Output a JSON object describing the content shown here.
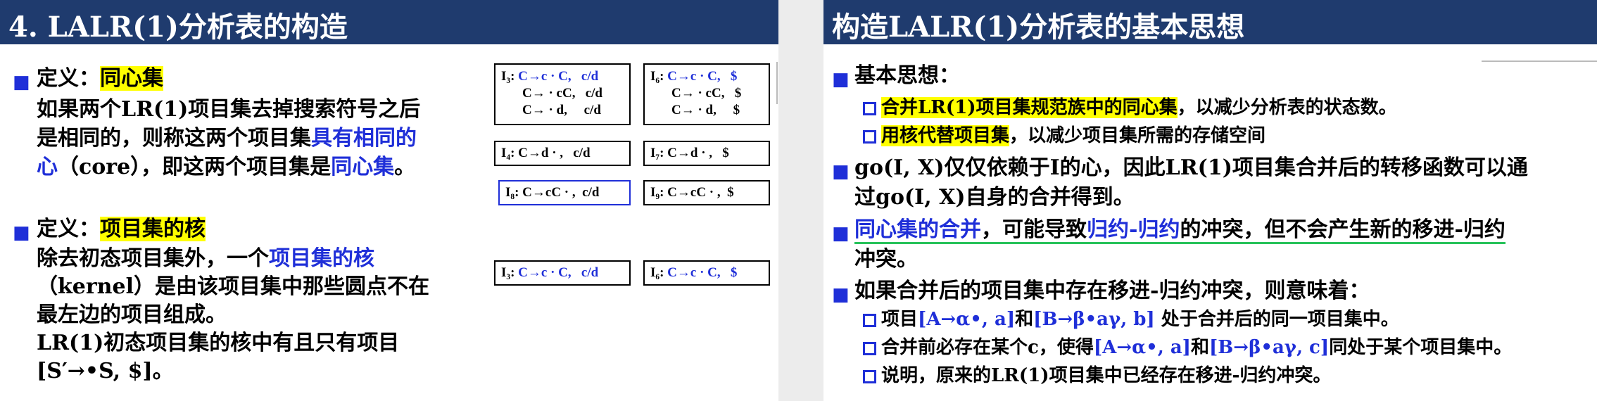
{
  "left": {
    "title": "4. LALR(1)分析表的构造",
    "def1": {
      "label": "定义：",
      "term": "同心集",
      "line1": "如果两个LR(1)项目集去掉搜索符号之后",
      "line2a": "是相同的，则称这两个项目集",
      "line2b": "具有相同的",
      "line3a": "心",
      "line3b": "（core），即这两个项目集是",
      "line3c": "同心集",
      "line3d": "。"
    },
    "def2": {
      "label": "定义：",
      "term": "项目集的核",
      "line1a": "除去初态项目集外，一个",
      "line1b": "项目集的核",
      "line2": "（kernel）是由该项目集中那些圆点不在",
      "line3": "最左边的项目组成。",
      "line4": "LR(1)初态项目集的核中有且只有项目",
      "line5": "[S′→•S, $]。"
    },
    "boxes": {
      "i3": {
        "name": "I₃:",
        "l1": "C→c · C,   c/d",
        "l2": "C→ · cC,   c/d",
        "l3": "C→ · d,     c/d"
      },
      "i6": {
        "name": "I₆:",
        "l1": "C→c · C,   $",
        "l2": "C→ · cC,   $",
        "l3": "C→ · d,     $"
      },
      "i4": {
        "name": "I₄:",
        "l1": "C→d · ,   c/d"
      },
      "i7": {
        "name": "I₇:",
        "l1": "C→d · ,   $"
      },
      "i8": {
        "name": "I₈:",
        "l1": "C→cC · ,  c/d"
      },
      "i9": {
        "name": "I₉:",
        "l1": "C→cC · ,  $"
      },
      "i3b": {
        "name": "I₃:",
        "l1": "C→c · C,   c/d"
      },
      "i6b": {
        "name": "I₆:",
        "l1": "C→c · C,   $"
      }
    }
  },
  "right": {
    "title": "构造LALR(1)分析表的基本思想",
    "b1": "基本思想：",
    "b1s1a": "合并LR(1)项目集规范族中的同心集",
    "b1s1b": "，以减少分析表的状态数。",
    "b1s2a": "用核代替项目集",
    "b1s2b": "，以减少项目集所需的存储空间",
    "b2l1": "go(I, X)仅仅依赖于I的心，因此LR(1)项目集合并后的转移函数可以通",
    "b2l2": "过go(I, X)自身的合并得到。",
    "b3a": "同心集的合并",
    "b3b": "，可能导致",
    "b3c": "归约-归约",
    "b3d": "的冲突，但不会产生新的移进-归约",
    "b3l2": "冲突。",
    "b4": "如果合并后的项目集中存在移进-归约冲突，则意味着：",
    "b4s1a": "项目",
    "b4s1b": "[A→α•, a]",
    "b4s1c": "和",
    "b4s1d": "[B→β•aγ, b]",
    "b4s1e": " 处于合并后的同一项目集中。",
    "b4s2a": "合并前必存在某个c，使得",
    "b4s2b": "[A→α•, a]",
    "b4s2c": "和",
    "b4s2d": "[B→β•aγ, c]",
    "b4s2e": "同处于某个项目集中。",
    "b4s3": "说明，原来的LR(1)项目集中已经存在移进-归约冲突。"
  }
}
